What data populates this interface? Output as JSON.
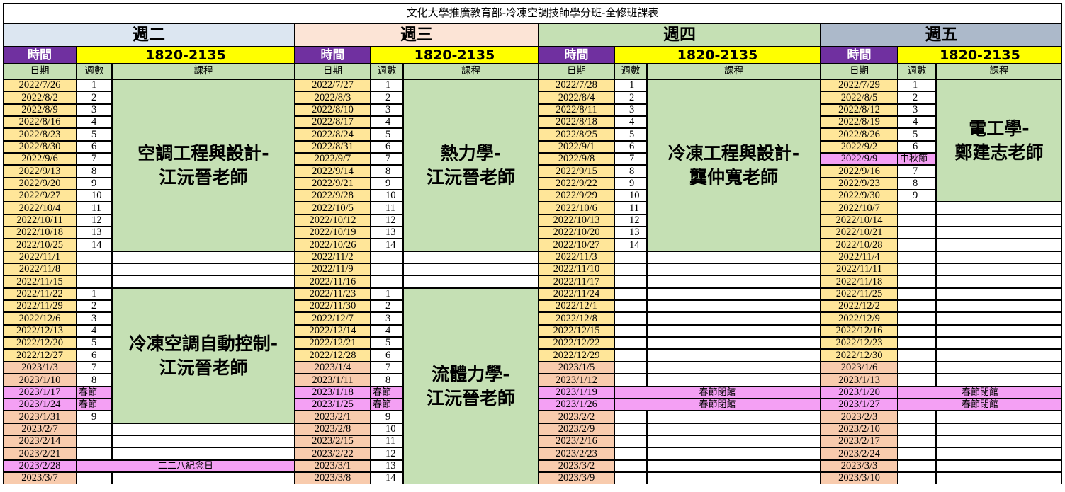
{
  "title": "文化大學推廣教育部-冷凍空調技師學分班-全修班課表",
  "time_label": "時間",
  "time_value": "1820-2135",
  "col_headers": [
    "日期",
    "週數",
    "課程"
  ],
  "days": [
    {
      "name": "週二",
      "head_color": "#dce6f1",
      "dates": [
        "2022/7/26",
        "2022/8/2",
        "2022/8/9",
        "2022/8/16",
        "2022/8/23",
        "2022/8/30",
        "2022/9/6",
        "2022/9/13",
        "2022/9/20",
        "2022/9/27",
        "2022/10/4",
        "2022/10/11",
        "2022/10/18",
        "2022/10/25",
        "2022/11/1",
        "2022/11/8",
        "2022/11/15",
        "2022/11/22",
        "2022/11/29",
        "2022/12/6",
        "2022/12/13",
        "2022/12/20",
        "2022/12/27",
        "2023/1/3",
        "2023/1/10",
        "2023/1/17",
        "2023/1/24",
        "2023/1/31",
        "2023/2/7",
        "2023/2/14",
        "2023/2/21",
        "2023/2/28",
        "2023/3/7"
      ],
      "date_colors": [
        "y",
        "y",
        "y",
        "y",
        "y",
        "y",
        "y",
        "y",
        "y",
        "y",
        "y",
        "y",
        "y",
        "y",
        "y",
        "y",
        "y",
        "y",
        "y",
        "y",
        "y",
        "y",
        "y",
        "o",
        "o",
        "p",
        "p",
        "o",
        "o",
        "o",
        "o",
        "p",
        "o"
      ],
      "weeks": [
        "1",
        "2",
        "3",
        "4",
        "5",
        "6",
        "7",
        "8",
        "9",
        "10",
        "11",
        "12",
        "13",
        "14",
        "",
        "",
        "",
        "1",
        "2",
        "3",
        "4",
        "5",
        "6",
        "7",
        "8",
        "春節",
        "春節",
        "9",
        "",
        "",
        "",
        "",
        ""
      ],
      "courses": [
        {
          "start": 0,
          "end": 13,
          "lines": [
            "空調工程與設計-",
            "江沅晉老師"
          ]
        },
        {
          "start": 17,
          "end": 27,
          "lines": [
            "冷凍空調自動控制-",
            "江沅晉老師"
          ]
        }
      ],
      "spans": [
        {
          "row": 31,
          "text": "二二八紀念日"
        }
      ]
    },
    {
      "name": "週三",
      "head_color": "#fce4d6",
      "dates": [
        "2022/7/27",
        "2022/8/3",
        "2022/8/10",
        "2022/8/17",
        "2022/8/24",
        "2022/8/31",
        "2022/9/7",
        "2022/9/14",
        "2022/9/21",
        "2022/9/28",
        "2022/10/5",
        "2022/10/12",
        "2022/10/19",
        "2022/10/26",
        "2022/11/2",
        "2022/11/9",
        "2022/11/16",
        "2022/11/23",
        "2022/11/30",
        "2022/12/7",
        "2022/12/14",
        "2022/12/21",
        "2022/12/28",
        "2023/1/4",
        "2023/1/11",
        "2023/1/18",
        "2023/1/25",
        "2023/2/1",
        "2023/2/8",
        "2023/2/15",
        "2023/2/22",
        "2023/3/1",
        "2023/3/8"
      ],
      "date_colors": [
        "y",
        "y",
        "y",
        "y",
        "y",
        "y",
        "y",
        "y",
        "y",
        "y",
        "y",
        "y",
        "y",
        "y",
        "y",
        "y",
        "y",
        "y",
        "y",
        "y",
        "y",
        "y",
        "y",
        "o",
        "o",
        "p",
        "p",
        "o",
        "o",
        "o",
        "o",
        "o",
        "o"
      ],
      "weeks": [
        "1",
        "2",
        "3",
        "4",
        "5",
        "6",
        "7",
        "8",
        "9",
        "10",
        "11",
        "12",
        "13",
        "14",
        "",
        "",
        "",
        "1",
        "2",
        "3",
        "4",
        "5",
        "6",
        "7",
        "8",
        "春節",
        "春節",
        "9",
        "10",
        "11",
        "12",
        "13",
        "14"
      ],
      "courses": [
        {
          "start": 0,
          "end": 13,
          "lines": [
            "熱力學-",
            "江沅晉老師"
          ]
        },
        {
          "start": 17,
          "end": 32,
          "lines": [
            "流體力學-",
            "江沅晉老師"
          ]
        }
      ],
      "spans": []
    },
    {
      "name": "週四",
      "head_color": "#c5e0b4",
      "dates": [
        "2022/7/28",
        "2022/8/4",
        "2022/8/11",
        "2022/8/18",
        "2022/8/25",
        "2022/9/1",
        "2022/9/8",
        "2022/9/15",
        "2022/9/22",
        "2022/9/29",
        "2022/10/6",
        "2022/10/13",
        "2022/10/20",
        "2022/10/27",
        "2022/11/3",
        "2022/11/10",
        "2022/11/17",
        "2022/11/24",
        "2022/12/1",
        "2022/12/8",
        "2022/12/15",
        "2022/12/22",
        "2022/12/29",
        "2023/1/5",
        "2023/1/12",
        "2023/1/19",
        "2023/1/26",
        "2023/2/2",
        "2023/2/9",
        "2023/2/16",
        "2023/2/23",
        "2023/3/2",
        "2023/3/9"
      ],
      "date_colors": [
        "y",
        "y",
        "y",
        "y",
        "y",
        "y",
        "y",
        "y",
        "y",
        "y",
        "y",
        "y",
        "y",
        "y",
        "y",
        "y",
        "y",
        "y",
        "y",
        "y",
        "y",
        "y",
        "y",
        "o",
        "o",
        "p",
        "p",
        "o",
        "o",
        "o",
        "o",
        "o",
        "o"
      ],
      "weeks": [
        "1",
        "2",
        "3",
        "4",
        "5",
        "6",
        "7",
        "8",
        "9",
        "10",
        "11",
        "12",
        "13",
        "14",
        "",
        "",
        "",
        "",
        "",
        "",
        "",
        "",
        "",
        "",
        "",
        "",
        "",
        "",
        "",
        "",
        "",
        "",
        ""
      ],
      "courses": [
        {
          "start": 0,
          "end": 13,
          "lines": [
            "冷凍工程與設計-",
            "龔仲寬老師"
          ]
        }
      ],
      "spans": [
        {
          "row": 25,
          "text": "春節閉館"
        },
        {
          "row": 26,
          "text": "春節閉館"
        }
      ]
    },
    {
      "name": "週五",
      "head_color": "#acb9ca",
      "dates": [
        "2022/7/29",
        "2022/8/5",
        "2022/8/12",
        "2022/8/19",
        "2022/8/26",
        "2022/9/2",
        "2022/9/9",
        "2022/9/16",
        "2022/9/23",
        "2022/9/30",
        "2022/10/7",
        "2022/10/14",
        "2022/10/21",
        "2022/10/28",
        "2022/11/4",
        "2022/11/11",
        "2022/11/18",
        "2022/11/25",
        "2022/12/2",
        "2022/12/9",
        "2022/12/16",
        "2022/12/23",
        "2022/12/30",
        "2023/1/6",
        "2023/1/13",
        "2023/1/20",
        "2023/1/27",
        "2023/2/3",
        "2023/2/10",
        "2023/2/17",
        "2023/2/24",
        "2023/3/3",
        "2023/3/10"
      ],
      "date_colors": [
        "y",
        "y",
        "y",
        "y",
        "y",
        "y",
        "p",
        "y",
        "y",
        "y",
        "y",
        "y",
        "y",
        "y",
        "y",
        "y",
        "y",
        "y",
        "y",
        "y",
        "y",
        "y",
        "y",
        "o",
        "o",
        "p",
        "p",
        "o",
        "o",
        "o",
        "o",
        "o",
        "o"
      ],
      "weeks": [
        "1",
        "2",
        "3",
        "4",
        "5",
        "6",
        "中秋節",
        "7",
        "8",
        "9",
        "",
        "",
        "",
        "",
        "",
        "",
        "",
        "",
        "",
        "",
        "",
        "",
        "",
        "",
        "",
        "",
        "",
        "",
        "",
        "",
        "",
        "",
        ""
      ],
      "courses": [
        {
          "start": 0,
          "end": 9,
          "lines": [
            "電工學-",
            "鄭建志老師"
          ]
        }
      ],
      "spans": [
        {
          "row": 25,
          "text": "春節閉館"
        },
        {
          "row": 26,
          "text": "春節閉館"
        }
      ]
    }
  ]
}
